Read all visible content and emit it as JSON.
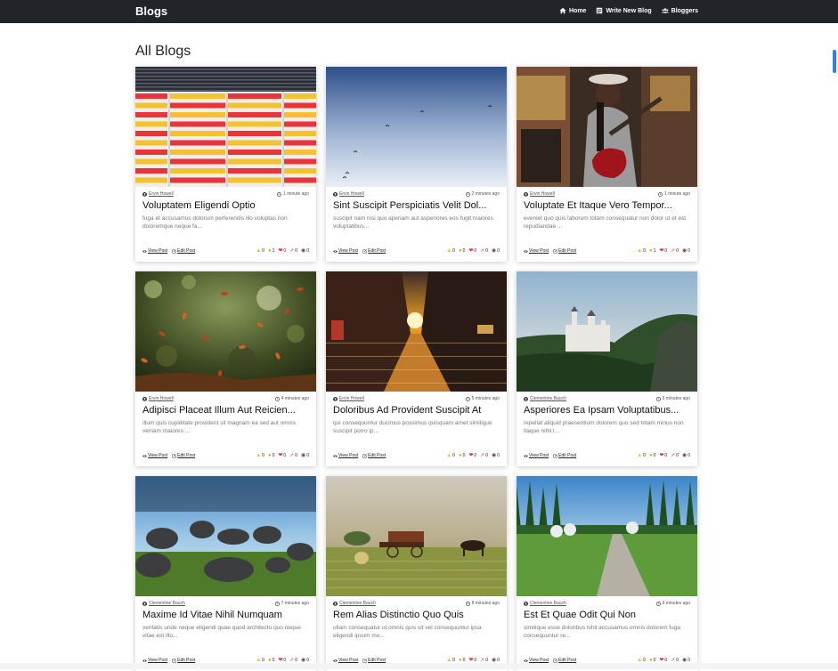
{
  "nav": {
    "brand": "Blogs",
    "links": [
      {
        "label": "Home",
        "icon": "home-icon"
      },
      {
        "label": "Write New Blog",
        "icon": "write-icon"
      },
      {
        "label": "Bloggers",
        "icon": "users-icon"
      }
    ]
  },
  "page_title": "All Blogs",
  "labels": {
    "view": "View Post",
    "edit": "Edit Post"
  },
  "reaction_icons": [
    "thumbs-up-icon",
    "wow-icon",
    "heart-icon",
    "rocket-icon",
    "eyes-icon"
  ],
  "posts": [
    {
      "author": "Ervin Howell",
      "time": "1 minute ago",
      "title": "Voluptatem Eligendi Optio",
      "excerpt": "fuga et accusamus dolorum perferendis illo voluptas non doloremque neque fa...",
      "reactions": [
        "0",
        "1",
        "0",
        "0",
        "0"
      ],
      "image": "striped-building-image"
    },
    {
      "author": "Ervin Howell",
      "time": "2 minutes ago",
      "title": "Sint Suscipit Perspiciatis Velit Dol...",
      "excerpt": "suscipit nam nisi quo aperiam aut asperiores eos fugit maiores voluptatibus...",
      "reactions": [
        "0",
        "0",
        "0",
        "0",
        "0"
      ],
      "image": "sky-birds-image"
    },
    {
      "author": "Ervin Howell",
      "time": "1 minute ago",
      "title": "Voluptate Et Itaque Vero Tempor...",
      "excerpt": "eveniet quo quis laborum totam consequatur non dolor ut et est repudiandae ...",
      "reactions": [
        "0",
        "1",
        "0",
        "0",
        "0"
      ],
      "image": "guitar-woman-image"
    },
    {
      "author": "Ervin Howell",
      "time": "4 minutes ago",
      "title": "Adipisci Placeat Illum Aut Reicien...",
      "excerpt": "illum quis cupiditate provident sit magnam ea sed aut omnis veniam maiores ...",
      "reactions": [
        "0",
        "0",
        "0",
        "0",
        "0"
      ],
      "image": "autumn-leaves-image"
    },
    {
      "author": "Ervin Howell",
      "time": "5 minutes ago",
      "title": "Doloribus Ad Provident Suscipit At",
      "excerpt": "qui consequuntur ducimus possimus quisquam amet similique suscipit porro ip...",
      "reactions": [
        "0",
        "0",
        "0",
        "0",
        "0"
      ],
      "image": "sunset-street-image"
    },
    {
      "author": "Clementine Bauch",
      "time": "6 minutes ago",
      "title": "Asperiores Ea Ipsam Voluptatibus...",
      "excerpt": "repellat aliquid praesentium dolorem quo sed totam minus non itaque nihil l...",
      "reactions": [
        "0",
        "0",
        "0",
        "0",
        "0"
      ],
      "image": "castle-forest-image"
    },
    {
      "author": "Clementine Bauch",
      "time": "7 minutes ago",
      "title": "Maxime Id Vitae Nihil Numquam",
      "excerpt": "veritatis unde neque eligendi quae quod architecto quo neque vitae est illo...",
      "reactions": [
        "0",
        "0",
        "0",
        "0",
        "0"
      ],
      "image": "stones-field-image"
    },
    {
      "author": "Clementine Bauch",
      "time": "8 minutes ago",
      "title": "Rem Alias Distinctio Quo Quis",
      "excerpt": "ullam consequatur ut omnis quis sit vel consequuntur ipsa eligendi ipsum mo...",
      "reactions": [
        "0",
        "0",
        "0",
        "0",
        "0"
      ],
      "image": "horses-farm-image"
    },
    {
      "author": "Clementine Bauch",
      "time": "9 minutes ago",
      "title": "Est Et Quae Odit Qui Non",
      "excerpt": "similique esse doloribus nihil accusamus omnis dolorem fuga consequuntur re...",
      "reactions": [
        "0",
        "0",
        "0",
        "0",
        "0"
      ],
      "image": "forest-path-image"
    }
  ]
}
